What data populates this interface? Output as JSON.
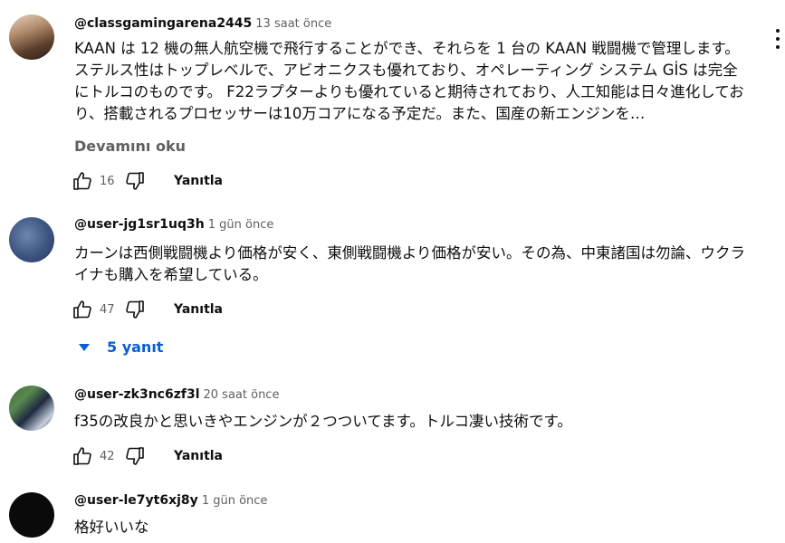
{
  "comments": [
    {
      "author": "@classgamingarena2445",
      "time": "13 saat önce",
      "text": "KAAN は 12 機の無人航空機で飛行することができ、それらを 1 台の KAAN 戦闘機で管理します。ステルス性はトップレベルで、アビオニクスも優れており、オペレーティング システム GİS は完全にトルコのものです。 F22ラプターよりも優れていると期待されており、人工知能は日々進化しており、搭載されるプロセッサーは10万コアになる予定だ。また、国産の新エンジンを…",
      "more": "Devamını oku",
      "likes": "16",
      "reply": "Yanıtla"
    },
    {
      "author": "@user-jg1sr1uq3h",
      "time": "1 gün önce",
      "text": "カーンは西側戦闘機より価格が安く、東側戦闘機より価格が安い。その為、中東諸国は勿論、ウクライナも購入を希望している。",
      "likes": "47",
      "reply": "Yanıtla",
      "replies": "5 yanıt"
    },
    {
      "author": "@user-zk3nc6zf3l",
      "time": "20 saat önce",
      "text": "f35の改良かと思いきやエンジンが２つついてます。トルコ凄い技術です。",
      "likes": "42",
      "reply": "Yanıtla"
    },
    {
      "author": "@user-le7yt6xj8y",
      "time": "1 gün önce",
      "text": "格好いいな"
    }
  ],
  "icons": {
    "like": "thumb-up-icon",
    "dislike": "thumb-down-icon",
    "menu": "more-vert-icon",
    "expand": "arrow-drop-down-icon"
  },
  "colors": {
    "link_blue": "#065fd4",
    "secondary_text": "#606060",
    "primary_text": "#0f0f0f"
  }
}
